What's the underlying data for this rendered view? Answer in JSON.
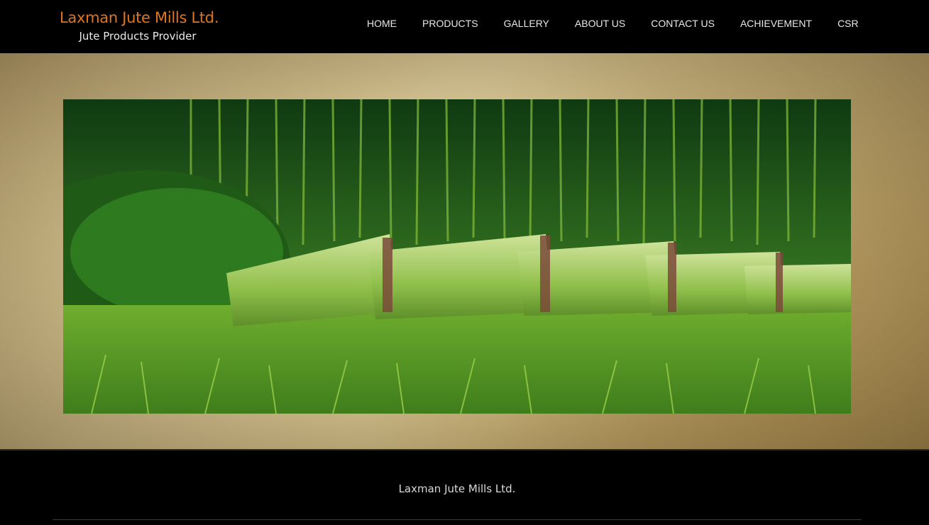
{
  "brand": {
    "title": "Laxman Jute Mills Ltd.",
    "tagline": "Jute Products Provider"
  },
  "nav": {
    "items": [
      {
        "label": "HOME"
      },
      {
        "label": "PRODUCTS"
      },
      {
        "label": "GALLERY"
      },
      {
        "label": "ABOUT US"
      },
      {
        "label": "CONTACT US"
      },
      {
        "label": "ACHIEVEMENT"
      },
      {
        "label": "CSR"
      }
    ]
  },
  "footer": {
    "company_name": "Laxman Jute Mills Ltd."
  },
  "colors": {
    "brand_accent": "#e0751f",
    "header_bg": "#000000",
    "nav_text": "#e8e8e8"
  }
}
